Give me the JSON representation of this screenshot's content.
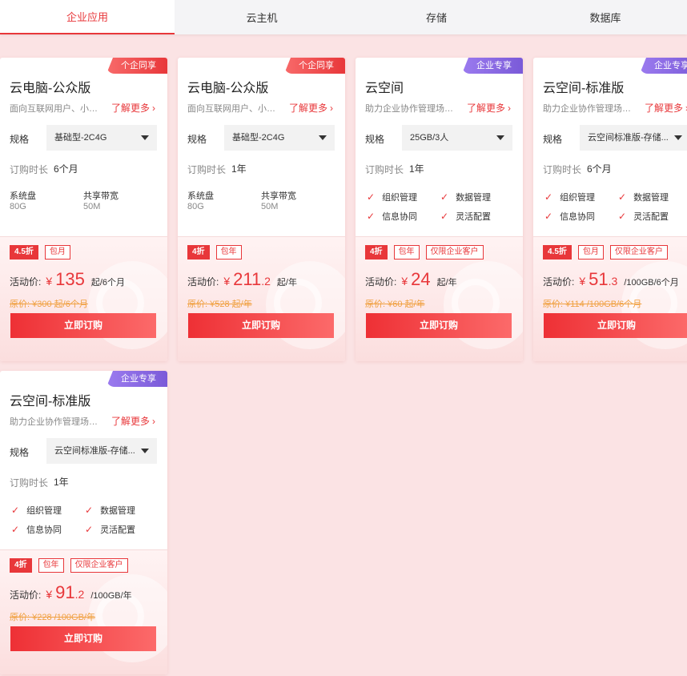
{
  "tabs": [
    "企业应用",
    "云主机",
    "存储",
    "数据库"
  ],
  "labels": {
    "spec": "规格",
    "duration": "订购时长",
    "activity_price": "活动价:",
    "buy": "立即订购",
    "learn_more": "了解更多"
  },
  "cards": [
    {
      "ribbon": "个企同享",
      "ribbon_color": "red",
      "title": "云电脑-公众版",
      "desc": "面向互联网用户、小微企业...",
      "spec_value": "基础型-2C4G",
      "duration": "6个月",
      "specs": [
        {
          "k": "系统盘",
          "v": "80G"
        },
        {
          "k": "共享带宽",
          "v": "50M"
        }
      ],
      "tags": [
        "4.5折",
        "包月"
      ],
      "price_int": "135",
      "price_dec": "",
      "unit": "起/6个月",
      "orig": "原价: ¥300 起/6个月"
    },
    {
      "ribbon": "个企同享",
      "ribbon_color": "red",
      "title": "云电脑-公众版",
      "desc": "面向互联网用户、小微企业...",
      "spec_value": "基础型-2C4G",
      "duration": "1年",
      "specs": [
        {
          "k": "系统盘",
          "v": "80G"
        },
        {
          "k": "共享带宽",
          "v": "50M"
        }
      ],
      "tags": [
        "4折",
        "包年"
      ],
      "price_int": "211",
      "price_dec": ".2",
      "unit": "起/年",
      "orig": "原价: ¥528 起/年"
    },
    {
      "ribbon": "企业专享",
      "ribbon_color": "purple",
      "title": "云空间",
      "desc": "助力企业协作管理场景...",
      "spec_value": "25GB/3人",
      "duration": "1年",
      "features": [
        "组织管理",
        "数据管理",
        "信息协同",
        "灵活配置"
      ],
      "tags": [
        "4折",
        "包年",
        "仅限企业客户"
      ],
      "price_int": "24",
      "price_dec": "",
      "unit": "起/年",
      "orig": "原价: ¥60 起/年"
    },
    {
      "ribbon": "企业专享",
      "ribbon_color": "purple",
      "title": "云空间-标准版",
      "desc": "助力企业协作管理场景...",
      "spec_value": "云空间标准版-存储...",
      "duration": "6个月",
      "features": [
        "组织管理",
        "数据管理",
        "信息协同",
        "灵活配置"
      ],
      "tags": [
        "4.5折",
        "包月",
        "仅限企业客户"
      ],
      "price_int": "51",
      "price_dec": ".3",
      "unit": "/100GB/6个月",
      "orig": "原价: ¥114 /100GB/6个月"
    },
    {
      "ribbon": "企业专享",
      "ribbon_color": "purple",
      "title": "云空间-标准版",
      "desc": "助力企业协作管理场景...",
      "spec_value": "云空间标准版-存储...",
      "duration": "1年",
      "features": [
        "组织管理",
        "数据管理",
        "信息协同",
        "灵活配置"
      ],
      "tags": [
        "4折",
        "包年",
        "仅限企业客户"
      ],
      "price_int": "91",
      "price_dec": ".2",
      "unit": "/100GB/年",
      "orig": "原价: ¥228 /100GB/年"
    }
  ]
}
